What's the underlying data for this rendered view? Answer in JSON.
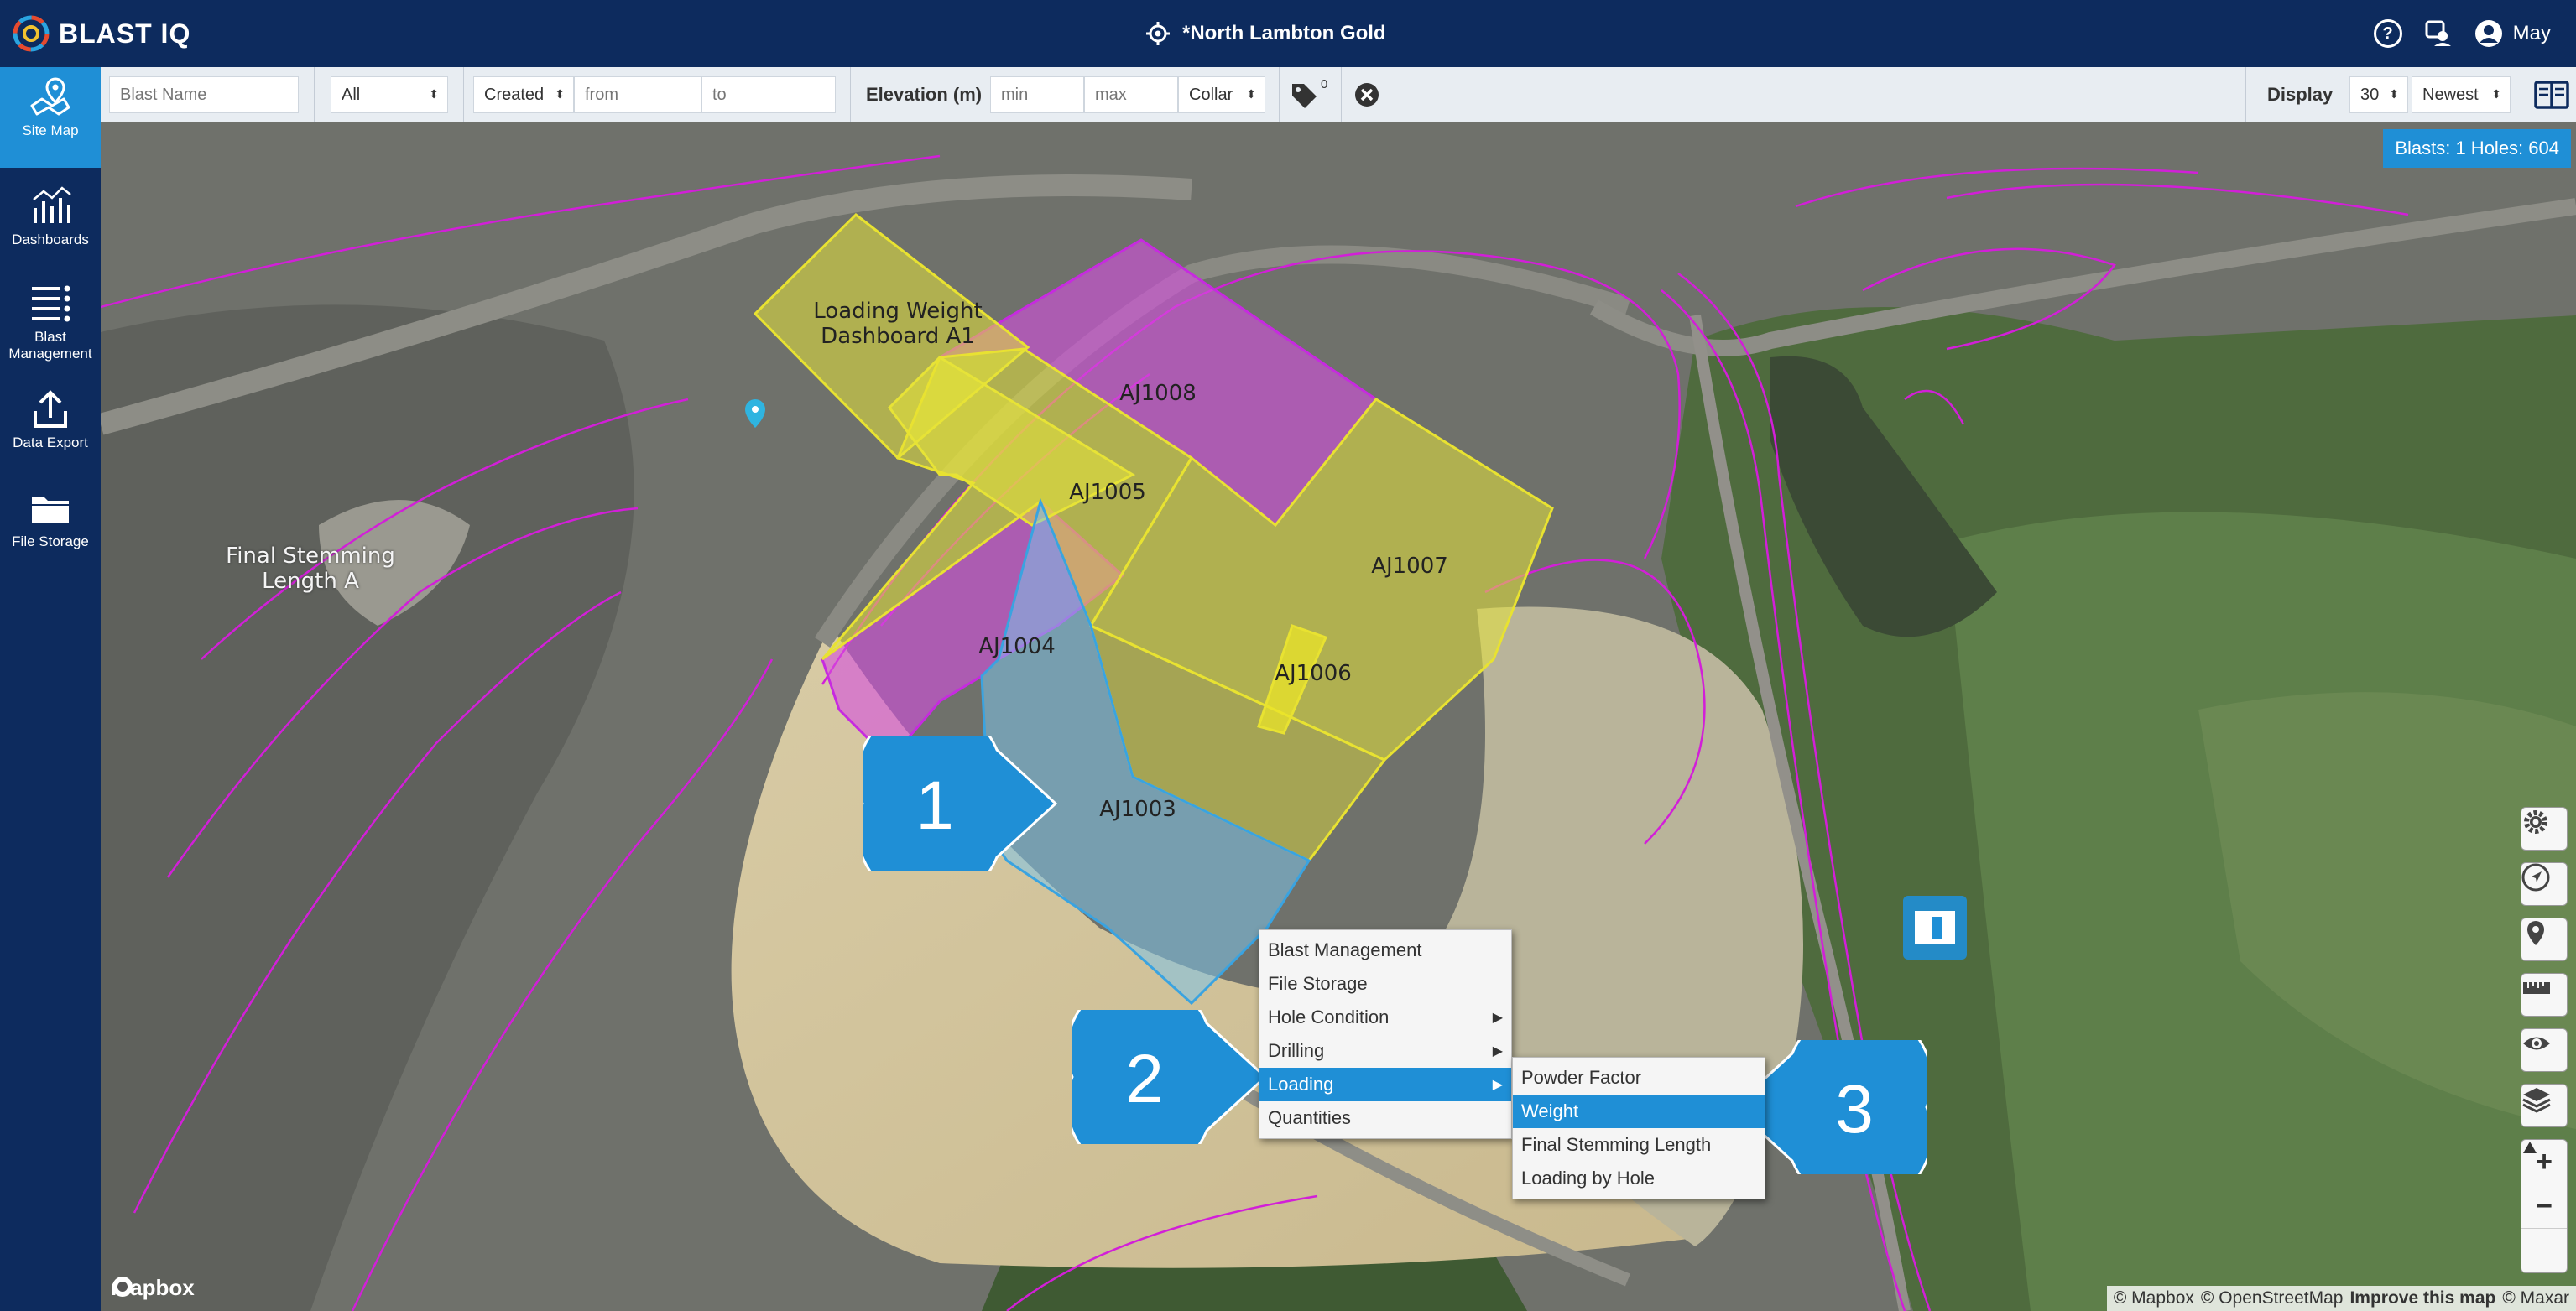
{
  "app": {
    "logo_text": "BLAST IQ",
    "site_title": "*North Lambton Gold",
    "user": "May"
  },
  "sidebar": {
    "items": [
      {
        "label": "Site Map"
      },
      {
        "label": "Dashboards"
      },
      {
        "label": "Blast Management"
      },
      {
        "label": "Data Export"
      },
      {
        "label": "File Storage"
      }
    ]
  },
  "filters": {
    "blast_name_placeholder": "Blast Name",
    "status_value": "All",
    "date_field_value": "Created",
    "from_placeholder": "from",
    "to_placeholder": "to",
    "elevation_label": "Elevation (m)",
    "min_placeholder": "min",
    "max_placeholder": "max",
    "elevation_type_value": "Collar",
    "tag_count": "0",
    "display_label": "Display",
    "display_count_value": "30",
    "sort_value": "Newest"
  },
  "map": {
    "counter": "Blasts: 1 Holes: 604",
    "polygons": [
      {
        "label": "Loading Weight Dashboard A1"
      },
      {
        "label": "AJ1008"
      },
      {
        "label": "AJ1005"
      },
      {
        "label": "AJ1007"
      },
      {
        "label": "AJ1004"
      },
      {
        "label": "AJ1006"
      },
      {
        "label": "AJ1003"
      }
    ],
    "text_label": "Final Stemming Length A",
    "mapbox_logo": "mapbox",
    "attribution": {
      "mapbox": "© Mapbox",
      "osm": "© OpenStreetMap",
      "improve": "Improve this map",
      "maxar": "© Maxar"
    }
  },
  "context_menu": {
    "items": [
      {
        "label": "Blast Management",
        "submenu": false
      },
      {
        "label": "File Storage",
        "submenu": false
      },
      {
        "label": "Hole Condition",
        "submenu": true
      },
      {
        "label": "Drilling",
        "submenu": true
      },
      {
        "label": "Loading",
        "submenu": true,
        "highlighted": true
      },
      {
        "label": "Quantities",
        "submenu": false
      }
    ],
    "submenu_items": [
      {
        "label": "Powder Factor"
      },
      {
        "label": "Weight",
        "highlighted": true
      },
      {
        "label": "Final Stemming Length"
      },
      {
        "label": "Loading by Hole"
      }
    ]
  },
  "callouts": [
    "1",
    "2",
    "3"
  ],
  "colors": {
    "navbar": "#0d2b5e",
    "accent": "#1f8fd6",
    "yellow_poly": "#e6e33a",
    "magenta_poly": "#d54fe0",
    "blue_poly": "#7dc3e8"
  }
}
